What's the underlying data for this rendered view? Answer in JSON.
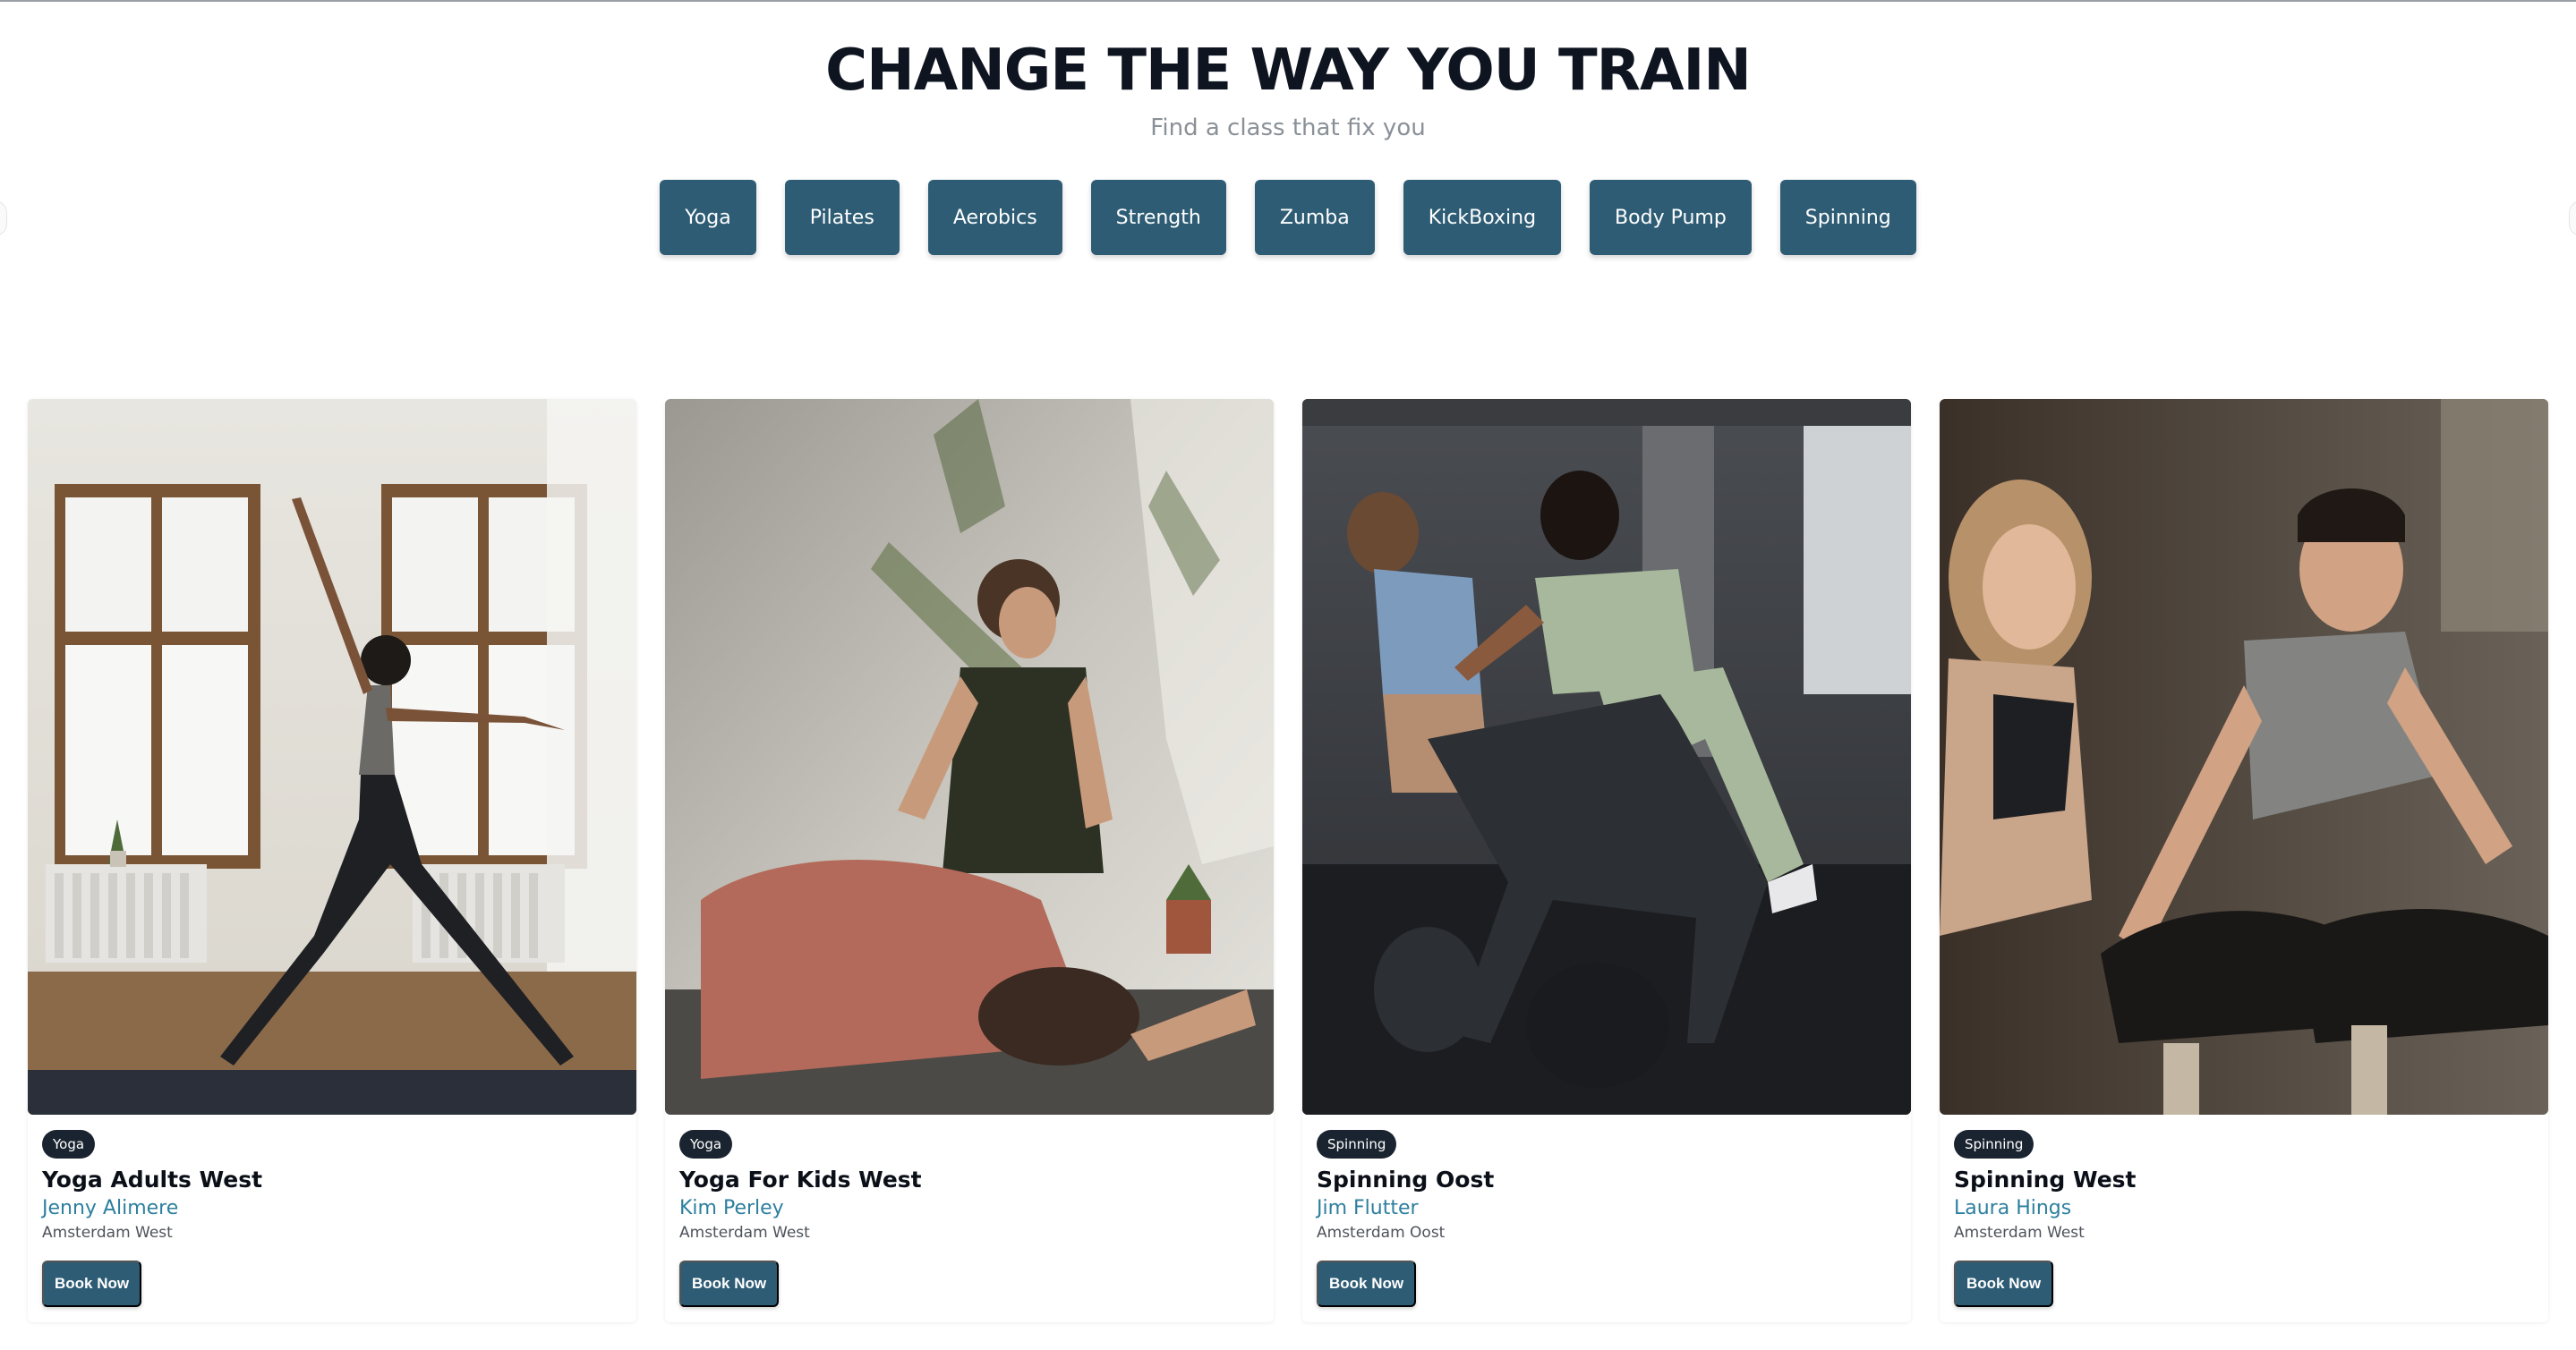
{
  "hero": {
    "title": "CHANGE THE WAY YOU TRAIN",
    "subtitle": "Find a class that fix you"
  },
  "class_tabs": [
    "Yoga",
    "Pilates",
    "Aerobics",
    "Strength",
    "Zumba",
    "KickBoxing",
    "Body Pump",
    "Spinning"
  ],
  "cards": [
    {
      "category": "Yoga",
      "name": "Yoga Adults West",
      "trainer": "Jenny Alimere",
      "location": "Amsterdam West",
      "button": "Book Now"
    },
    {
      "category": "Yoga",
      "name": "Yoga For Kids West",
      "trainer": "Kim Perley",
      "location": "Amsterdam West",
      "button": "Book Now"
    },
    {
      "category": "Spinning",
      "name": "Spinning Oost",
      "trainer": "Jim Flutter",
      "location": "Amsterdam Oost",
      "button": "Book Now"
    },
    {
      "category": "Spinning",
      "name": "Spinning West",
      "trainer": "Laura Hings",
      "location": "Amsterdam West",
      "button": "Book Now"
    }
  ],
  "colors": {
    "accent": "#2d5c74",
    "trainer_link": "#2d7f9e",
    "badge": "#1a2430"
  }
}
